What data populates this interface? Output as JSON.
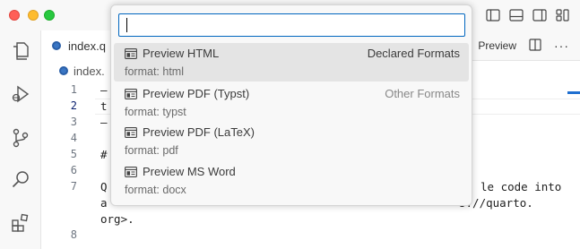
{
  "tab": {
    "filename": "index.q"
  },
  "tab_actions": {
    "preview_label": "Preview",
    "more_label": "···"
  },
  "breadcrumb": {
    "filename": "index."
  },
  "editor": {
    "line_numbers": [
      "1",
      "2",
      "3",
      "4",
      "5",
      "6",
      "7",
      "",
      "8"
    ],
    "lines": {
      "l1": "—",
      "l2": "t",
      "l3": "—",
      "l5": "#",
      "l7a": "Q",
      "l7b": "a",
      "l7c": "org>."
    },
    "right_text": {
      "l7_right": "le code into",
      "l7b_right": "s://quarto."
    }
  },
  "quick_pick": {
    "input_value": "",
    "items": [
      {
        "label": "Preview HTML",
        "detail": "format: html",
        "separator": "Declared Formats"
      },
      {
        "label": "Preview PDF (Typst)",
        "detail": "format: typst",
        "separator": "Other Formats"
      },
      {
        "label": "Preview PDF (LaTeX)",
        "detail": "format: pdf",
        "separator": ""
      },
      {
        "label": "Preview MS Word",
        "detail": "format: docx",
        "separator": ""
      }
    ]
  },
  "colors": {
    "focus_border": "#0066bf",
    "selected_bg": "#e4e4e4",
    "quarto_blue": "#3a76c4"
  }
}
